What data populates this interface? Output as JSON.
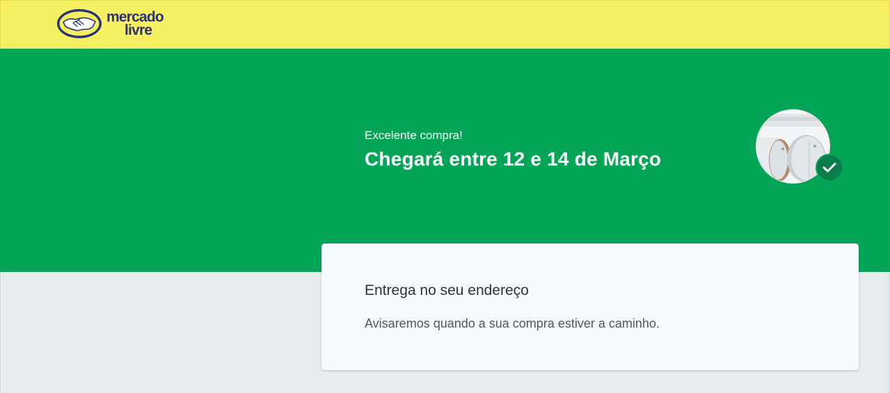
{
  "header": {
    "logo_line1": "mercado",
    "logo_line2": "livre"
  },
  "hero": {
    "subtitle": "Excelente compra!",
    "title": "Chegará entre 12 e 14 de Março",
    "badge_icon": "check-icon"
  },
  "card": {
    "title": "Entrega no seu endereço",
    "description": "Avisaremos quando a sua compra estiver a caminho."
  },
  "colors": {
    "header_bg": "#f5ef62",
    "hero_bg": "#02a556",
    "brand_blue": "#2d3277",
    "badge_bg": "#0a7e4a",
    "page_bg": "#e7ebee",
    "card_bg": "#f4f9fd"
  }
}
